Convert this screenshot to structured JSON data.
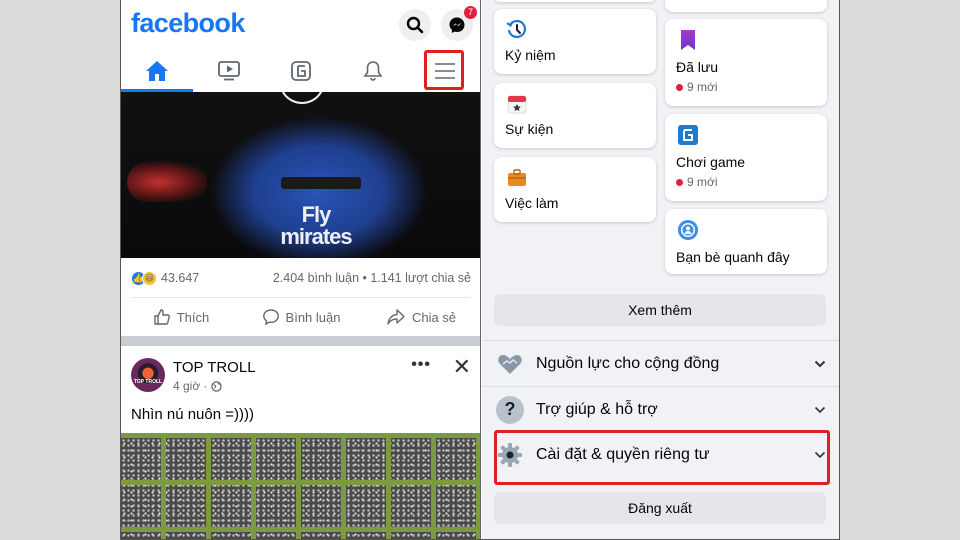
{
  "left": {
    "logo": "facebook",
    "messenger_badge": "7",
    "tabs": [
      {
        "name": "home",
        "active": true
      },
      {
        "name": "watch",
        "active": false
      },
      {
        "name": "gaming",
        "active": false
      },
      {
        "name": "notifications",
        "active": false
      },
      {
        "name": "menu",
        "active": false,
        "highlighted": true
      }
    ],
    "video": {
      "shirt_line1": "Fly",
      "shirt_line2": "mirates"
    },
    "stats": {
      "reactions": "43.647",
      "comments_shares": "2.404 bình luận • 1.141 lượt chia sẻ"
    },
    "actions": {
      "like": "Thích",
      "comment": "Bình luận",
      "share": "Chia sẻ"
    },
    "post": {
      "author": "TOP TROLL",
      "avatar_text": "TOP TROLL",
      "time": "4 giờ ·",
      "more": "•••",
      "close": "✕",
      "text": "Nhìn nú nuôn =))))"
    }
  },
  "right": {
    "left_cards": [
      {
        "label": "Kỷ niệm",
        "icon": "memories-clock-icon"
      },
      {
        "label": "Sự kiện",
        "icon": "events-calendar-icon"
      },
      {
        "label": "Việc làm",
        "icon": "jobs-briefcase-icon"
      }
    ],
    "right_cards": [
      {
        "label": "Đã lưu",
        "sub": "9 mới",
        "icon": "saved-bookmark-icon"
      },
      {
        "label": "Chơi game",
        "sub": "9 mới",
        "icon": "gaming-icon"
      },
      {
        "label": "Bạn bè quanh đây",
        "icon": "nearby-friends-icon"
      }
    ],
    "see_more": "Xem thêm",
    "menu_rows": [
      {
        "label": "Nguồn lực cho cộng đồng",
        "chevron": "❯"
      },
      {
        "label": "Trợ giúp & hỗ trợ",
        "chevron": "❯"
      },
      {
        "label": "Cài đặt & quyền riêng tư",
        "chevron": "❯",
        "highlighted": true
      }
    ],
    "logout": "Đăng xuất"
  },
  "colors": {
    "brand_blue": "#1877f2",
    "highlight_red": "#e02020",
    "notification_red": "#e41e3f",
    "menu_bg": "#f0f2f5"
  }
}
